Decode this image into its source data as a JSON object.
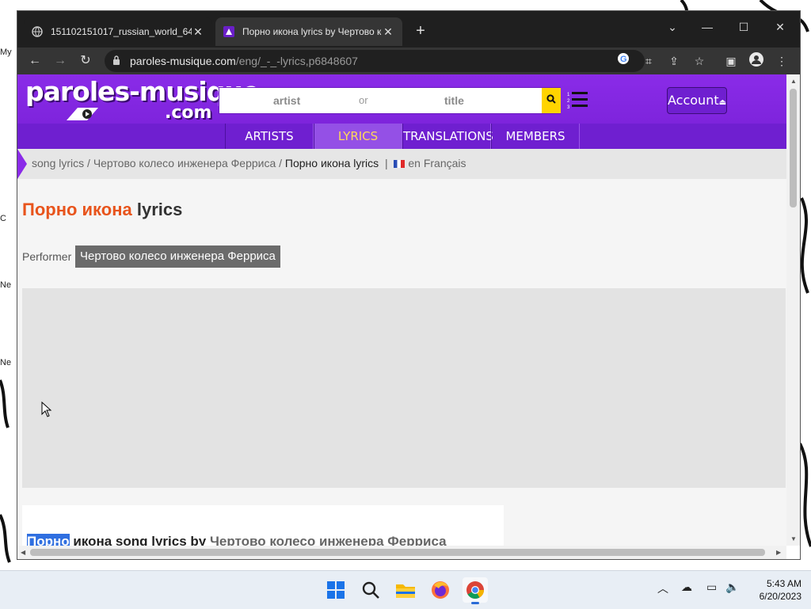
{
  "browser": {
    "tabs": [
      {
        "title": "151102151017_russian_world_64",
        "active": false
      },
      {
        "title": "Порно икона lyrics by Чертово колесо",
        "active": true
      }
    ],
    "url_domain": "paroles-musique.com",
    "url_path": "/eng/_-_-lyrics,p6848607"
  },
  "site": {
    "logo_main": "paroles-musique",
    "logo_sub": ".com",
    "search_artist_placeholder": "artist",
    "search_or": "or",
    "search_title_placeholder": "title",
    "account_label": "Account",
    "nav": [
      "ARTISTS",
      "LYRICS",
      "TRANSLATIONS",
      "MEMBERS"
    ],
    "nav_active": "LYRICS",
    "colors": {
      "header": "#7e24dc",
      "accent_orange": "#e8541c",
      "active_nav_text": "#ffd85a",
      "search_button": "#ffd400"
    }
  },
  "breadcrumb": {
    "song_lyrics": "song lyrics",
    "sep": " / ",
    "artist": "Чертово колесо инженера Ферриса",
    "current": "Порно икона lyrics",
    "divider": "|",
    "lang": "en Français"
  },
  "page": {
    "title_song": "Порно икона",
    "title_suffix": "lyrics",
    "performer_label": "Performer",
    "performer_name": "Чертово колесо инженера Ферриса",
    "lyrics_heading_hl": "Порно",
    "lyrics_heading_mid": " икона song lyrics by ",
    "lyrics_heading_artist": "Чертово колесо инженера Ферриса"
  },
  "taskbar": {
    "time": "5:43 AM",
    "date": "6/20/2023",
    "apps": [
      "start-icon",
      "search-icon",
      "file-explorer-icon",
      "firefox-icon",
      "chrome-icon"
    ],
    "active_app": "chrome-icon"
  },
  "desktop": {
    "icon_labels": [
      "My",
      "C",
      "Ne",
      "Ne"
    ]
  }
}
